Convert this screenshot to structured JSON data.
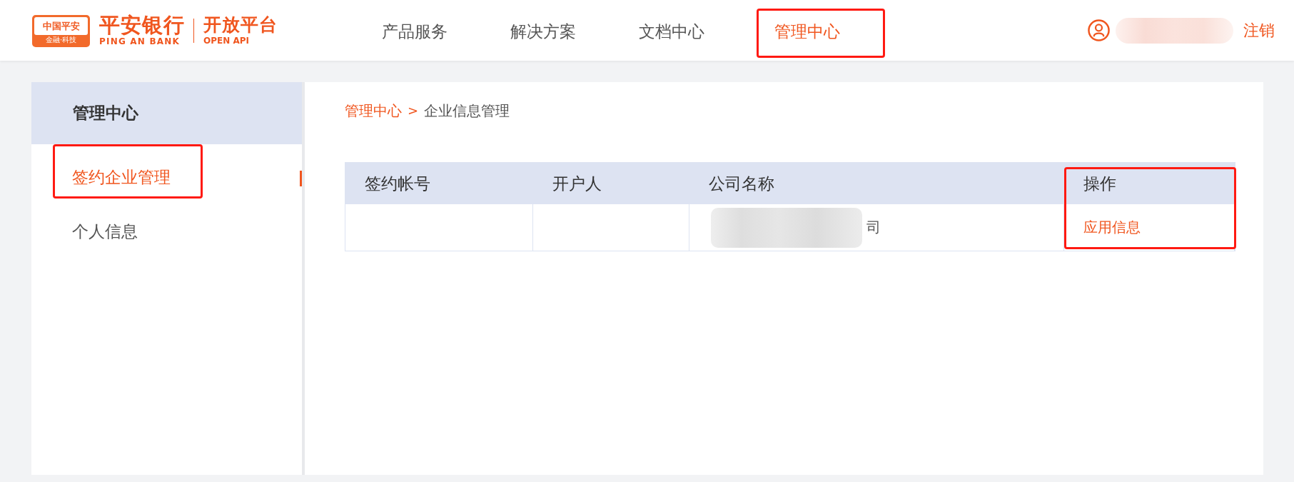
{
  "header": {
    "logo": {
      "badge_title": "中国平安",
      "badge_tagline": "金融·科技",
      "brand_name": "平安银行",
      "brand_latin": "PING AN BANK",
      "product_name": "开放平台",
      "product_latin": "OPEN API"
    },
    "nav": [
      {
        "label": "产品服务",
        "selected": false,
        "highlighted": false
      },
      {
        "label": "解决方案",
        "selected": false,
        "highlighted": false
      },
      {
        "label": "文档中心",
        "selected": false,
        "highlighted": false
      },
      {
        "label": "管理中心",
        "selected": true,
        "highlighted": true
      }
    ],
    "user": {
      "name_redacted": true,
      "logout": "注销"
    }
  },
  "sidebar": {
    "title": "管理中心",
    "items": [
      {
        "label": "签约企业管理",
        "selected": true,
        "highlighted": true
      },
      {
        "label": "个人信息",
        "selected": false,
        "highlighted": false
      }
    ]
  },
  "breadcrumb": {
    "items": [
      {
        "label": "管理中心",
        "kind": "link"
      },
      {
        "label": "企业信息管理",
        "kind": "current"
      }
    ],
    "separator": ">"
  },
  "table": {
    "columns": [
      {
        "label": "签约帐号",
        "highlighted": false
      },
      {
        "label": "开户人",
        "highlighted": false
      },
      {
        "label": "公司名称",
        "highlighted": false
      },
      {
        "label": "操作",
        "highlighted": true
      }
    ],
    "rows": [
      {
        "cells": [
          {
            "kind": "empty"
          },
          {
            "kind": "empty"
          },
          {
            "kind": "redacted",
            "text": "司"
          },
          {
            "kind": "link",
            "text": "应用信息"
          }
        ]
      }
    ]
  }
}
